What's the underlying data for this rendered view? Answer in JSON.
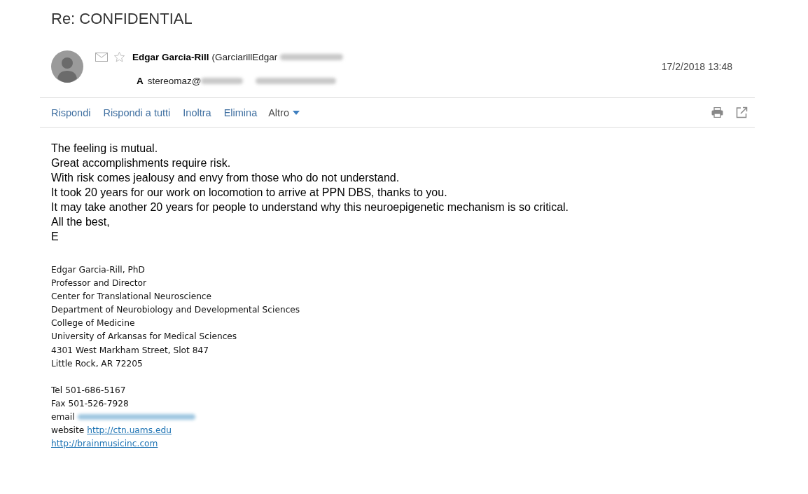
{
  "subject": "Re: CONFIDENTIAL",
  "sender": {
    "name": "Edgar Garcia-Rill",
    "address": "(GarciarillEdgar"
  },
  "recipients": {
    "label": "A",
    "visible": "stereomaz@"
  },
  "date": "17/2/2018 13:48",
  "actions": [
    {
      "label": "Rispondi",
      "kind": "link"
    },
    {
      "label": "Rispondi a tutti",
      "kind": "link"
    },
    {
      "label": "Inoltra",
      "kind": "link"
    },
    {
      "label": "Elimina",
      "kind": "link"
    },
    {
      "label": "Altro",
      "kind": "menu"
    }
  ],
  "body": [
    "The feeling is mutual.",
    "Great accomplishments require risk.",
    "With risk comes jealousy and envy from those who do not understand.",
    "It took 20 years for our work on locomotion to arrive at PPN DBS, thanks to you.",
    "It may take another 20 years for people to understand why this neuroepigenetic mechanism is so critical.",
    "All the best,",
    "E"
  ],
  "signature": [
    "Edgar Garcia-Rill, PhD",
    "Professor and Director",
    "Center for Translational Neuroscience",
    "Department of Neurobiology and Developmental Sciences",
    "College of Medicine",
    "University of Arkansas for Medical Sciences",
    "4301 West Markham Street, Slot 847",
    "Little Rock, AR 72205"
  ],
  "contacts": [
    {
      "kind": "text",
      "text": "Tel 501-686-5167"
    },
    {
      "kind": "text",
      "text": "Fax 501-526-7928"
    },
    {
      "kind": "blurred",
      "label": "email"
    },
    {
      "kind": "link",
      "label": "website",
      "url": "http://ctn.uams.edu"
    },
    {
      "kind": "link",
      "url": "http://brainmusicinc.com"
    }
  ]
}
